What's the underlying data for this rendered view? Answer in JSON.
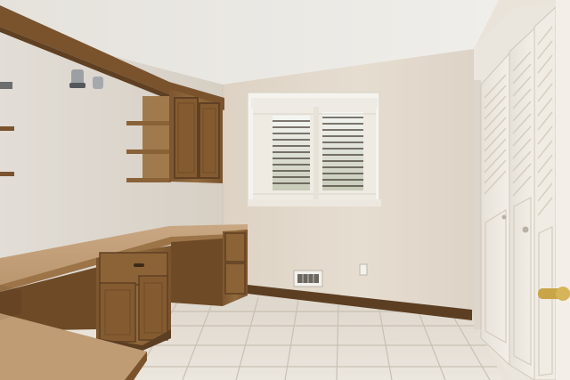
{
  "scene": {
    "kind": "photo",
    "subject": "empty room",
    "colors": {
      "ceiling": "#ebe9e4",
      "back_wall": "#e3d9cc",
      "left_wall": "#dcd6cd",
      "wood": "#8b6337",
      "wood_dark": "#6a4725",
      "countertop": "#c7a47f",
      "floor_tile": "#e6e0d6",
      "grout": "#c9c0b3",
      "baseboard": "#5c3e22",
      "closet_door": "#f2eee7",
      "window_frame": "#f5f3ee",
      "blinds": "#3a3129"
    }
  }
}
